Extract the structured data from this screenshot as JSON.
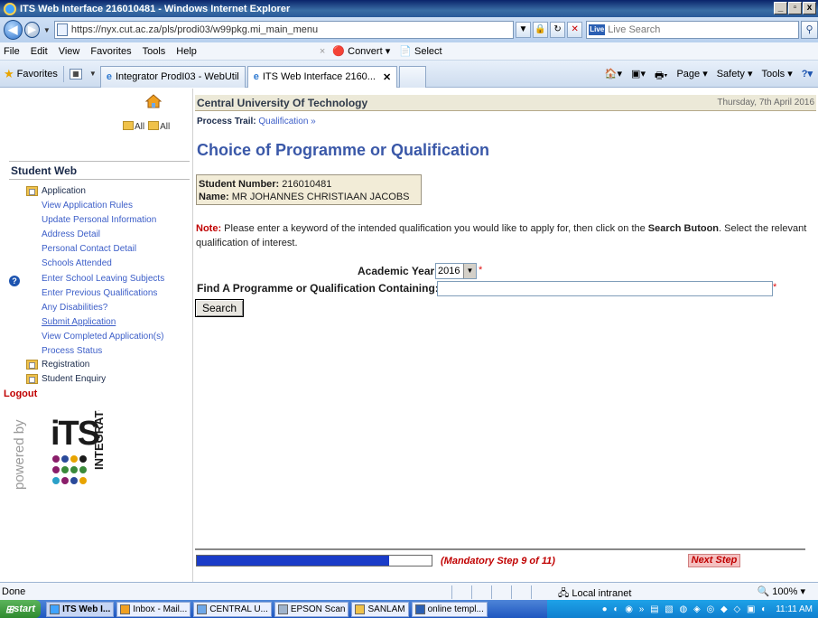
{
  "browser": {
    "window_title": "ITS Web Interface 216010481 - Windows Internet Explorer",
    "url": "https://nyx.cut.ac.za/pls/prodi03/w99pkg.mi_main_menu",
    "search_placeholder": "Live Search",
    "menu": [
      "File",
      "Edit",
      "View",
      "Favorites",
      "Tools",
      "Help"
    ],
    "convert_label": "Convert",
    "select_label": "Select",
    "favorites_label": "Favorites",
    "tabs": [
      "Integrator ProdI03 - WebUtil",
      "ITS Web Interface 2160..."
    ],
    "commands": [
      "Page",
      "Safety",
      "Tools"
    ]
  },
  "sidebar": {
    "all_expand": "All",
    "all_collapse": "All",
    "title": "Student Web",
    "application_label": "Application",
    "links": [
      "View Application Rules",
      "Update Personal Information",
      "Address Detail",
      "Personal Contact Detail",
      "Schools Attended",
      "Enter School Leaving Subjects",
      "Enter Previous Qualifications",
      "Any Disabilities?",
      "Submit Application",
      "View Completed Application(s)",
      "Process Status"
    ],
    "registration_label": "Registration",
    "enquiry_label": "Student Enquiry",
    "logout_label": "Logout",
    "powered_by": "powered by",
    "logo_text": "iTS",
    "logo_sub": "INTEGRATOR"
  },
  "main": {
    "university": "Central University Of Technology",
    "date": "Thursday, 7th April 2016",
    "trail_label": "Process Trail:",
    "trail_item": "Qualification",
    "title": "Choice of Programme or Qualification",
    "student_number_label": "Student Number:",
    "student_number": "216010481",
    "name_label": "Name:",
    "name": "MR JOHANNES CHRISTIAAN JACOBS",
    "note_label": "Note:",
    "note_text_1": " Please enter a keyword of the intended qualification you would like to apply for, then click on the ",
    "note_bold": "Search Butoon",
    "note_text_2": ". Select the relevant qualification of interest.",
    "academic_year_label": "Academic Year:",
    "academic_year": "2016",
    "find_label": "Find A Programme or Qualification Containing:",
    "find_value": "",
    "search_button": "Search",
    "progress_fraction": 0.8182,
    "mandatory_step": "(Mandatory Step 9 of 11)",
    "next_step": "Next Step"
  },
  "status": {
    "text": "Done",
    "zone": "Local intranet",
    "zoom": "100%"
  },
  "taskbar": {
    "start": "start",
    "items": [
      "ITS Web I...",
      "Inbox - Mail...",
      "CENTRAL U...",
      "EPSON Scan",
      "SANLAM",
      "online templ..."
    ],
    "clock": "11:11 AM"
  },
  "colors": {
    "title_blue": "#3a58a8",
    "link_blue": "#3c5ec8",
    "required_red": "#e01010",
    "progress_blue": "#1a3cc8"
  }
}
